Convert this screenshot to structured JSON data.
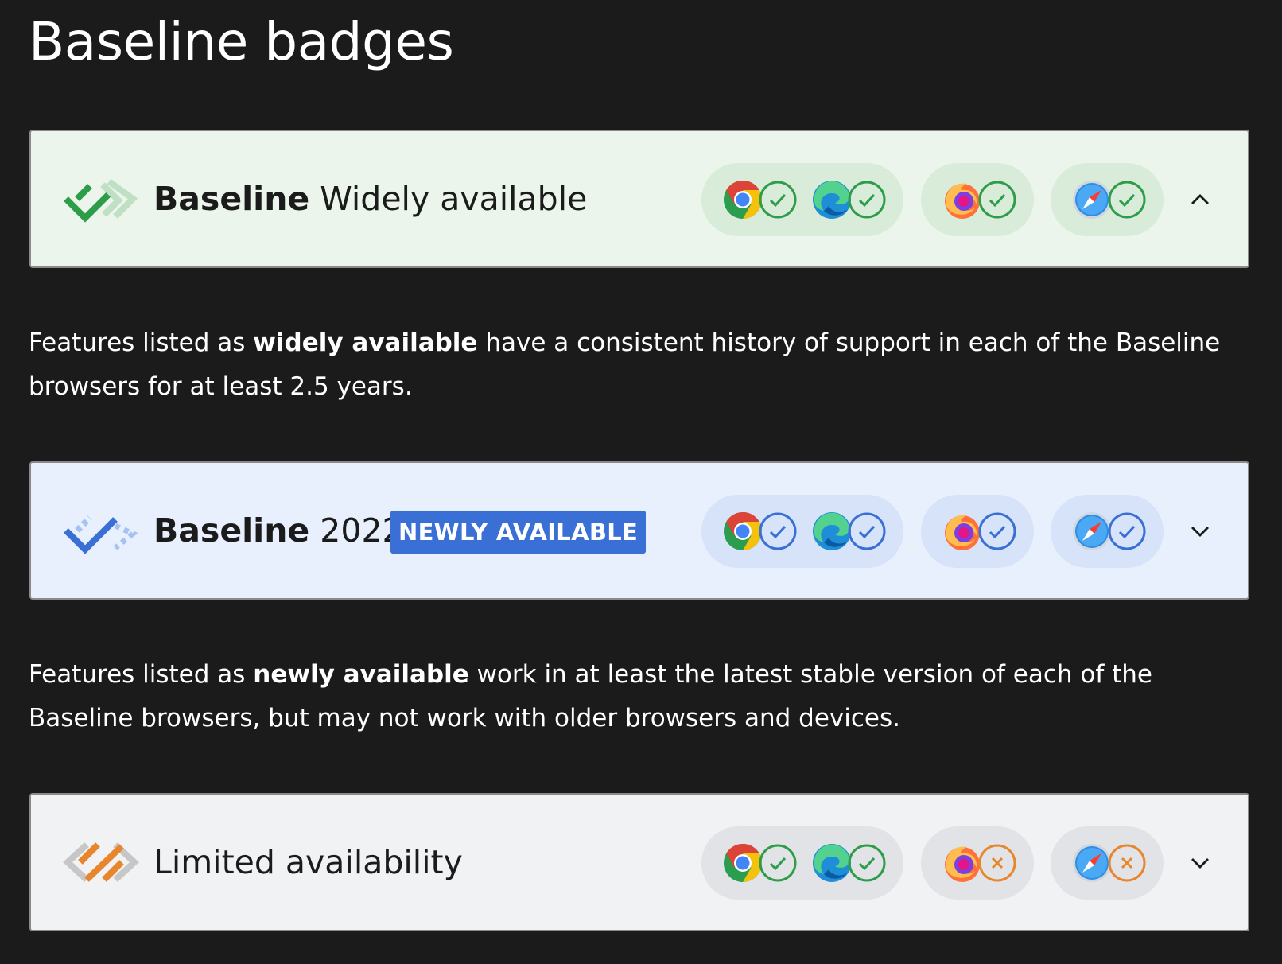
{
  "page": {
    "title": "Baseline badges"
  },
  "colors": {
    "widely_bg": "#ecf5ec",
    "newly_bg": "#e8f0fd",
    "limited_bg": "#f1f2f4",
    "check_green": "#2e9d4a",
    "check_blue": "#3a6fd6",
    "cross_orange": "#e8862d",
    "newly_tag": "#3a6fd6",
    "page_bg": "#1b1b1b"
  },
  "badges": {
    "widely": {
      "title_bold": "Baseline",
      "title_rest": "Widely available",
      "logo_icon": "baseline-widely-logo-icon",
      "browsers": [
        {
          "name": "chrome-icon",
          "status": "supported"
        },
        {
          "name": "edge-icon",
          "status": "supported"
        },
        {
          "name": "firefox-icon",
          "status": "supported"
        },
        {
          "name": "safari-icon",
          "status": "supported"
        }
      ],
      "toggle_icon": "chevron-up-icon",
      "expanded": true
    },
    "newly": {
      "title_bold": "Baseline",
      "title_rest": "2022",
      "tag": "NEWLY AVAILABLE",
      "logo_icon": "baseline-newly-logo-icon",
      "browsers": [
        {
          "name": "chrome-icon",
          "status": "supported"
        },
        {
          "name": "edge-icon",
          "status": "supported"
        },
        {
          "name": "firefox-icon",
          "status": "supported"
        },
        {
          "name": "safari-icon",
          "status": "supported"
        }
      ],
      "toggle_icon": "chevron-down-icon",
      "expanded": false
    },
    "limited": {
      "title": "Limited availability",
      "logo_icon": "limited-availability-logo-icon",
      "browsers": [
        {
          "name": "chrome-icon",
          "status": "supported"
        },
        {
          "name": "edge-icon",
          "status": "supported"
        },
        {
          "name": "firefox-icon",
          "status": "unsupported"
        },
        {
          "name": "safari-icon",
          "status": "unsupported"
        }
      ],
      "toggle_icon": "chevron-down-icon",
      "expanded": false
    }
  },
  "descriptions": {
    "widely": {
      "pre": "Features listed as ",
      "bold": "widely available",
      "post": " have a consistent history of support in each of the Baseline browsers for at least 2.5 years."
    },
    "newly": {
      "pre": "Features listed as ",
      "bold": "newly available",
      "post": " work in at least the latest stable version of each of the Baseline browsers, but may not work with older browsers and devices."
    }
  }
}
